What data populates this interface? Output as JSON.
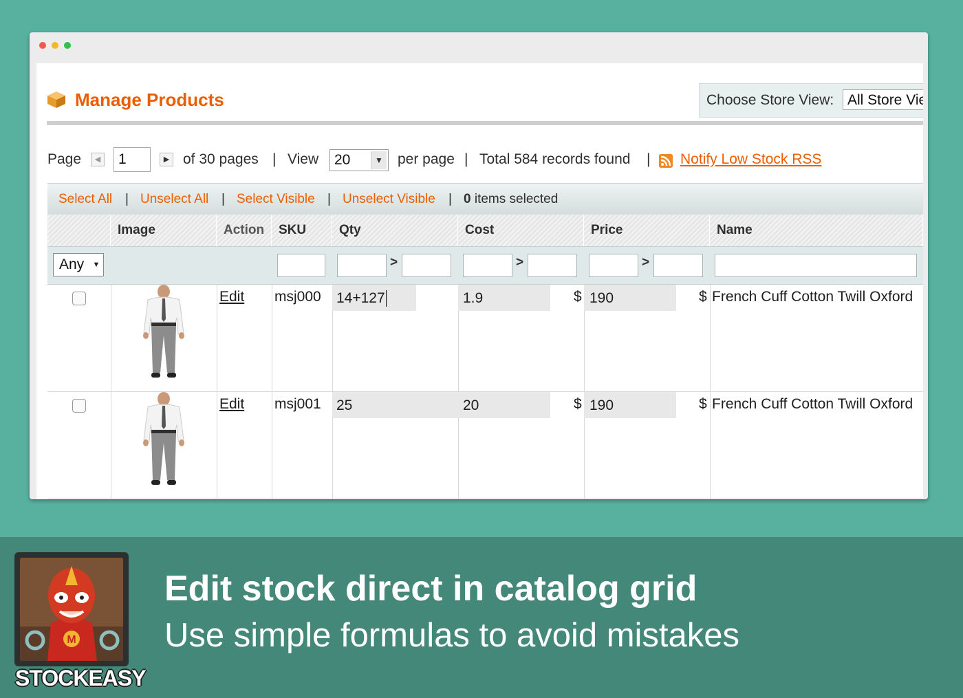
{
  "header": {
    "title": "Manage Products",
    "store_label": "Choose Store View:",
    "store_value": "All Store Views"
  },
  "pager": {
    "page_label": "Page",
    "page_value": "1",
    "of_pages": "of 30 pages",
    "view_label": "View",
    "view_value": "20",
    "per_page": "per page",
    "total": "Total 584 records found",
    "rss_link": "Notify Low Stock RSS",
    "separator": "|"
  },
  "mass": {
    "select_all": "Select All",
    "unselect_all": "Unselect All",
    "select_visible": "Select Visible",
    "unselect_visible": "Unselect Visible",
    "selected_count": "0",
    "selected_suffix": "items selected",
    "separator": "|"
  },
  "grid": {
    "columns": [
      "Image",
      "Action",
      "SKU",
      "Qty",
      "Cost",
      "Price",
      "Name"
    ],
    "filter_any": "Any",
    "range_sep": ">",
    "currency": "$",
    "rows": [
      {
        "action": "Edit",
        "sku": "msj000",
        "qty": "14+127",
        "cost": "1.9",
        "price": "190",
        "name": "French Cuff Cotton Twill Oxford"
      },
      {
        "action": "Edit",
        "sku": "msj001",
        "qty": "25",
        "cost": "20",
        "price": "190",
        "name": "French Cuff Cotton Twill Oxford"
      }
    ]
  },
  "banner": {
    "title": "Edit stock direct in catalog grid",
    "subtitle": "Use simple formulas to avoid mistakes",
    "brand": "STOCKEASY",
    "badge_letter": "M"
  },
  "colors": {
    "accent": "#eb5e00",
    "background": "#58b19f",
    "banner": "#438878"
  }
}
